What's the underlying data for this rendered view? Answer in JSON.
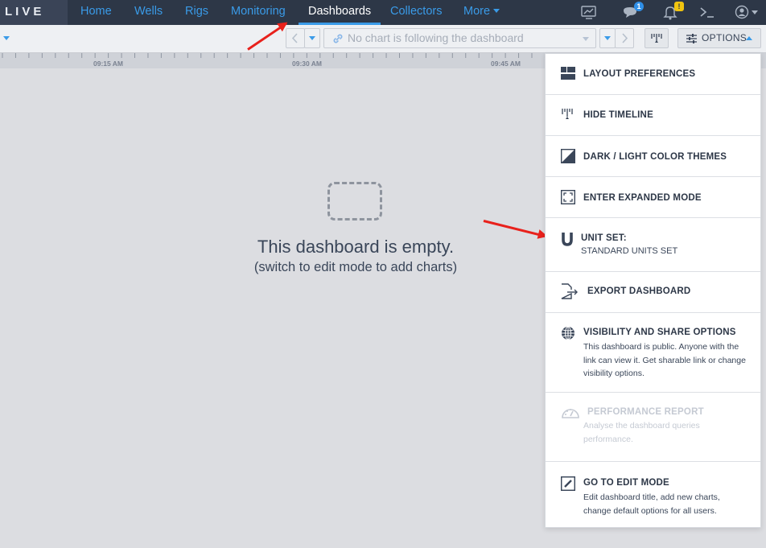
{
  "app": {
    "logo": "LIVE"
  },
  "nav": {
    "items": [
      {
        "label": "Home"
      },
      {
        "label": "Wells"
      },
      {
        "label": "Rigs"
      },
      {
        "label": "Monitoring"
      },
      {
        "label": "Dashboards",
        "active": true
      },
      {
        "label": "Collectors"
      },
      {
        "label": "More"
      }
    ],
    "notifications_count": "1",
    "alerts_badge": "!"
  },
  "toolbar": {
    "follow_placeholder": "No chart is following the dashboard",
    "options_label": "OPTIONS"
  },
  "timeline": {
    "ticks": [
      "09:15 AM",
      "09:30 AM",
      "09:45 AM"
    ]
  },
  "empty_state": {
    "title": "This dashboard is empty.",
    "subtitle": "(switch to edit mode to add charts)"
  },
  "options_menu": {
    "layout_preferences": "LAYOUT PREFERENCES",
    "hide_timeline": "HIDE TIMELINE",
    "color_themes": "DARK / LIGHT COLOR THEMES",
    "expanded_mode": "ENTER EXPANDED MODE",
    "unit_set_title": "UNIT SET:",
    "unit_set_value": "STANDARD UNITS SET",
    "export_dashboard": "EXPORT DASHBOARD",
    "visibility_title": "VISIBILITY AND SHARE OPTIONS",
    "visibility_desc": "This dashboard is public. Anyone with the link can view it. Get sharable link or change visibility options.",
    "performance_title": "PERFORMANCE REPORT",
    "performance_desc": "Analyse the dashboard queries performance.",
    "edit_mode_title": "GO TO EDIT MODE",
    "edit_mode_desc": "Edit dashboard title, add new charts, change default options for all users."
  },
  "colors": {
    "nav_bg": "#2d3747",
    "accent": "#3a9be8",
    "annotation_arrow": "#e8211c",
    "canvas_bg": "#dcdde1"
  }
}
